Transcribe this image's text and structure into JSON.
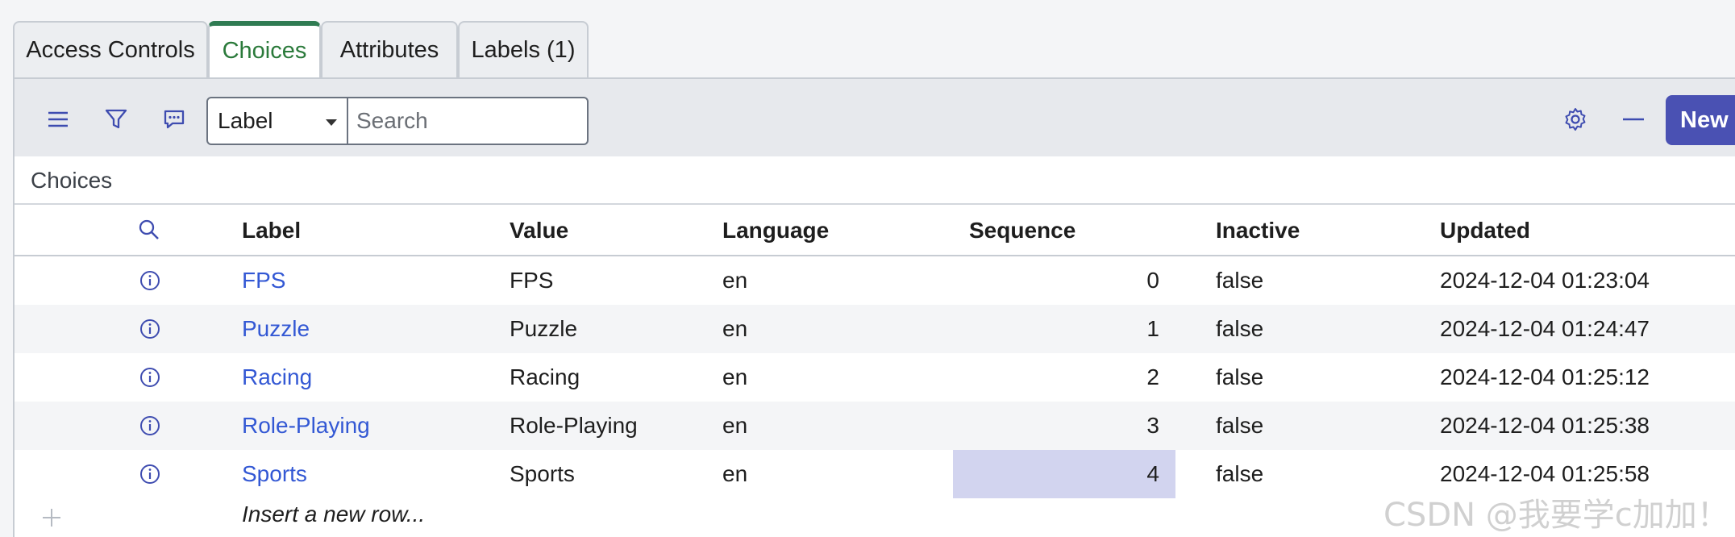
{
  "tabs": [
    {
      "label": "Access Controls",
      "active": false
    },
    {
      "label": "Choices",
      "active": true
    },
    {
      "label": "Attributes",
      "active": false
    },
    {
      "label": "Labels (1)",
      "active": false
    }
  ],
  "toolbar": {
    "menu_icon": "hamburger-menu-icon",
    "filter_icon": "filter-funnel-icon",
    "comment_icon": "comment-icon",
    "field_select": {
      "selected": "Label"
    },
    "search": {
      "placeholder": "Search",
      "value": ""
    },
    "settings_icon": "gear-icon",
    "collapse_icon": "minus-icon",
    "new_label": "New",
    "accent_color": "#4a51b3"
  },
  "list": {
    "title": "Choices",
    "columns": [
      "Label",
      "Value",
      "Language",
      "Sequence",
      "Inactive",
      "Updated"
    ],
    "rows": [
      {
        "label": "FPS",
        "value": "FPS",
        "language": "en",
        "sequence": "0",
        "inactive": "false",
        "updated": "2024-12-04 01:23:04"
      },
      {
        "label": "Puzzle",
        "value": "Puzzle",
        "language": "en",
        "sequence": "1",
        "inactive": "false",
        "updated": "2024-12-04 01:24:47"
      },
      {
        "label": "Racing",
        "value": "Racing",
        "language": "en",
        "sequence": "2",
        "inactive": "false",
        "updated": "2024-12-04 01:25:12"
      },
      {
        "label": "Role-Playing",
        "value": "Role-Playing",
        "language": "en",
        "sequence": "3",
        "inactive": "false",
        "updated": "2024-12-04 01:25:38"
      },
      {
        "label": "Sports",
        "value": "Sports",
        "language": "en",
        "sequence": "4",
        "inactive": "false",
        "updated": "2024-12-04 01:25:58"
      }
    ],
    "insert_row_text": "Insert a new row..."
  },
  "watermark": "CSDN @我要学c加加！"
}
